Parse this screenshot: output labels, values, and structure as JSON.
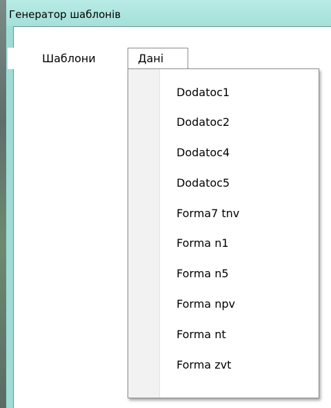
{
  "window": {
    "title": "Генератор шаблонів"
  },
  "menubar": {
    "items": [
      {
        "label": "Шаблони"
      },
      {
        "label": "Дані"
      }
    ]
  },
  "dropdown": {
    "items": [
      {
        "label": "Dodatoc1"
      },
      {
        "label": "Dodatoc2"
      },
      {
        "label": "Dodatoc4"
      },
      {
        "label": "Dodatoc5"
      },
      {
        "label": "Forma7 tnv"
      },
      {
        "label": "Forma n1"
      },
      {
        "label": "Forma n5"
      },
      {
        "label": "Forma npv"
      },
      {
        "label": "Forma nt"
      },
      {
        "label": "Forma zvt"
      }
    ]
  }
}
